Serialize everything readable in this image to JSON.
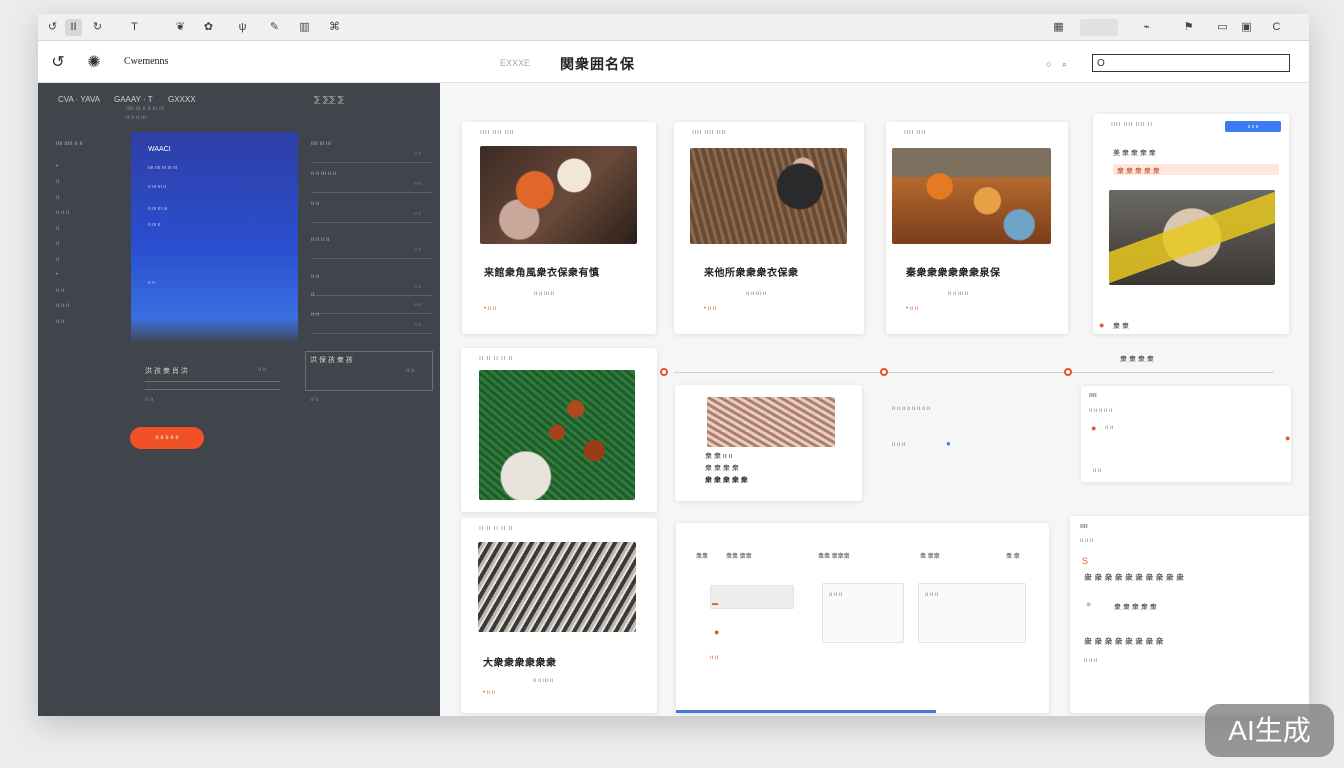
{
  "toolbar": {
    "items": [
      {
        "icon": "refresh-icon",
        "glyph": "↺"
      },
      {
        "icon": "page-icon",
        "glyph": "II"
      },
      {
        "icon": "history-icon",
        "glyph": "↻"
      },
      {
        "icon": "text-tool-icon",
        "glyph": "T"
      },
      {
        "icon": "leaf-icon",
        "glyph": "❦"
      },
      {
        "icon": "sprout-icon",
        "glyph": "✿"
      },
      {
        "icon": "plant-icon",
        "glyph": "ψ"
      },
      {
        "icon": "brush-icon",
        "glyph": "✎"
      },
      {
        "icon": "book-icon",
        "glyph": "▥"
      },
      {
        "icon": "tag-icon",
        "glyph": "⌘"
      },
      {
        "icon": "layout-icon",
        "glyph": "▦"
      },
      {
        "icon": "share-icon",
        "glyph": "⌁"
      },
      {
        "icon": "flag-icon",
        "glyph": "⚑"
      },
      {
        "icon": "window-icon",
        "glyph": "▭"
      },
      {
        "icon": "panel-icon",
        "glyph": "▣"
      },
      {
        "icon": "reload-icon",
        "glyph": "C"
      }
    ]
  },
  "header": {
    "brand": "Cwemenns",
    "subtitle": "EXXXE",
    "title": "関衆囲名保",
    "small_a": "○",
    "small_b": "⌕",
    "search_value": "O"
  },
  "left_panel": {
    "tabs": [
      "CVA · YAVA",
      "GAAAY · T",
      "GXXXX"
    ],
    "tab_right": "⅀ ⅀⅀ ⅀",
    "notes": [
      "ıılıı ııı ıı ıı ııı ııı",
      "ıı ıı ıı ııı"
    ],
    "nav_heading": "ıııı ııııı ıı ıı",
    "nav_items": [
      "•",
      "ıı",
      "ıı",
      "ıı  ıı ıı",
      "ıı",
      "ıı",
      "ıı",
      "•",
      "ıı ıı",
      "ıı ıı ıı",
      "ıı ıı"
    ],
    "hero": {
      "title": "WAACI",
      "lines": [
        "ıııı ıııı ııı ııı ııı",
        "ıı ııı ııı ıı",
        "ıı ııı ııı ııı",
        "ıı ııı ıı",
        "ıı ıı"
      ]
    },
    "form_rows": [
      {
        "label": "ıııı ııı ııı",
        "value": "ıı ıı"
      },
      {
        "label": "ıı ıı ııı ıı ıı",
        "value": "ıı ıı"
      },
      {
        "label": "ıı ıı",
        "value": "ıı ıı"
      },
      {
        "label": "ıı ıı ıı ıı",
        "value": "ıı ıı"
      },
      {
        "label": "ıı ıı",
        "value": "ıı ıı"
      },
      {
        "label": "ıı",
        "value": "ıı ıı"
      },
      {
        "label": "ıı ıı",
        "value": "ıı ıı"
      }
    ],
    "section_left": "洪 孩 衆 肖 洪",
    "section_left_right": "ıı ıı",
    "section_right": "洪 保 孩 衆 孩",
    "section_note": "ıı  ıı",
    "section_note_right": "ıı ıı",
    "cta": "ıı ıı ıı ıı ıı"
  },
  "cards": {
    "c1": {
      "label": "ıııı ıııı ıııı",
      "title": "来館衆角風衆衣保衆有慎",
      "meta": "ıı  ıı ııı ıı",
      "tags": "• ıı ıı"
    },
    "c2": {
      "label": "ıııı ıııı ıııı",
      "title": "来他所衆衆衆衣保衆",
      "meta": "ıı  ıı ııı ıı",
      "tags": "• ıı ıı"
    },
    "c3": {
      "label": "ıııı ıııı",
      "title": "秦衆衆衆衆衆衆泉保",
      "meta": "ıı  ıı ııı ıı",
      "tags": "• ıı ıı"
    },
    "c4": {
      "label": "ıııı ıııı ıııı ıı",
      "follow": "ıı ıı ıı",
      "line1": "美 衆 衆 衆 衆",
      "line2": "衆 衆 衆 衆 衆",
      "author": "衆 衆",
      "caption": "衆 衆 衆 衆"
    },
    "c5": {
      "label": "ıı ıı ıı ıı ıı"
    },
    "c6": {
      "label": "ıı ıı ıı ıı ıı",
      "title": "大衆衆衆衆衆衆",
      "meta": "ıı  ıı ııı ıı",
      "tags": "• ıı ıı"
    },
    "c7": {
      "line1": "衆 衆 ıı ıı",
      "line2": "衆 衆 衆 衆",
      "line3": "衆 衆 衆 衆 衆"
    },
    "timeline": {
      "row": "ıı  ıı ıı ıı ıı ıı ıı ıı",
      "sub": "ıı ıı ıı"
    },
    "c8": {
      "title": "ıııı",
      "line1": "ıı ıı ıı ıı ıı",
      "line2": "ıı ıı",
      "line3": "ıı ıı"
    },
    "c9": {
      "cols": [
        "衆衆",
        "衆衆 衆衆",
        "衆衆 衆衆衆",
        "衆 衆衆",
        "衆 衆"
      ],
      "item1": "ıı ıı ıı",
      "item2": "ıı ıı ıı",
      "tag": "ıı ıı"
    },
    "c10": {
      "title": "ıııı",
      "sub": "ıı ıı ıı",
      "rows": [
        "衆 衆 衆 衆 衆 衆 衆 衆 衆 衆",
        "衆 衆 衆 衆 衆",
        "衆 衆 衆 衆 衆 衆 衆 衆"
      ],
      "footer": "ıı ıı ıı"
    }
  },
  "watermark": "AI生成",
  "colors": {
    "accent": "#f05226",
    "panel": "#40454b",
    "hero": "#2a4fd0",
    "link": "#3d7cf0"
  }
}
